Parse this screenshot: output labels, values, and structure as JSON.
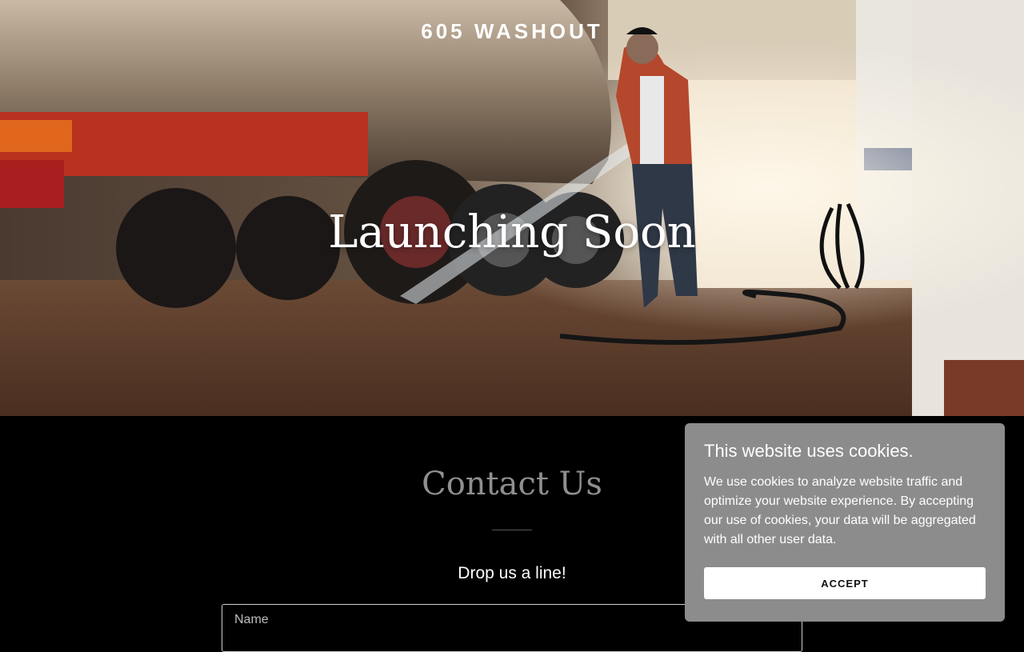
{
  "header": {
    "brand": "605 WASHOUT"
  },
  "hero": {
    "title": "Launching Soon",
    "image_alt": "Man pressure washing a tanker truck in a wash bay"
  },
  "contact": {
    "title": "Contact Us",
    "subtitle": "Drop us a line!",
    "name_placeholder": "Name"
  },
  "cookie_banner": {
    "title": "This website uses cookies.",
    "body": "We use cookies to analyze website traffic and optimize your website experience. By accepting our use of cookies, your data will be aggregated with all other user data.",
    "accept_label": "ACCEPT"
  },
  "colors": {
    "page_background": "#000000",
    "cookie_background": "#8c8c8c",
    "contact_title": "#8f8f8f"
  }
}
